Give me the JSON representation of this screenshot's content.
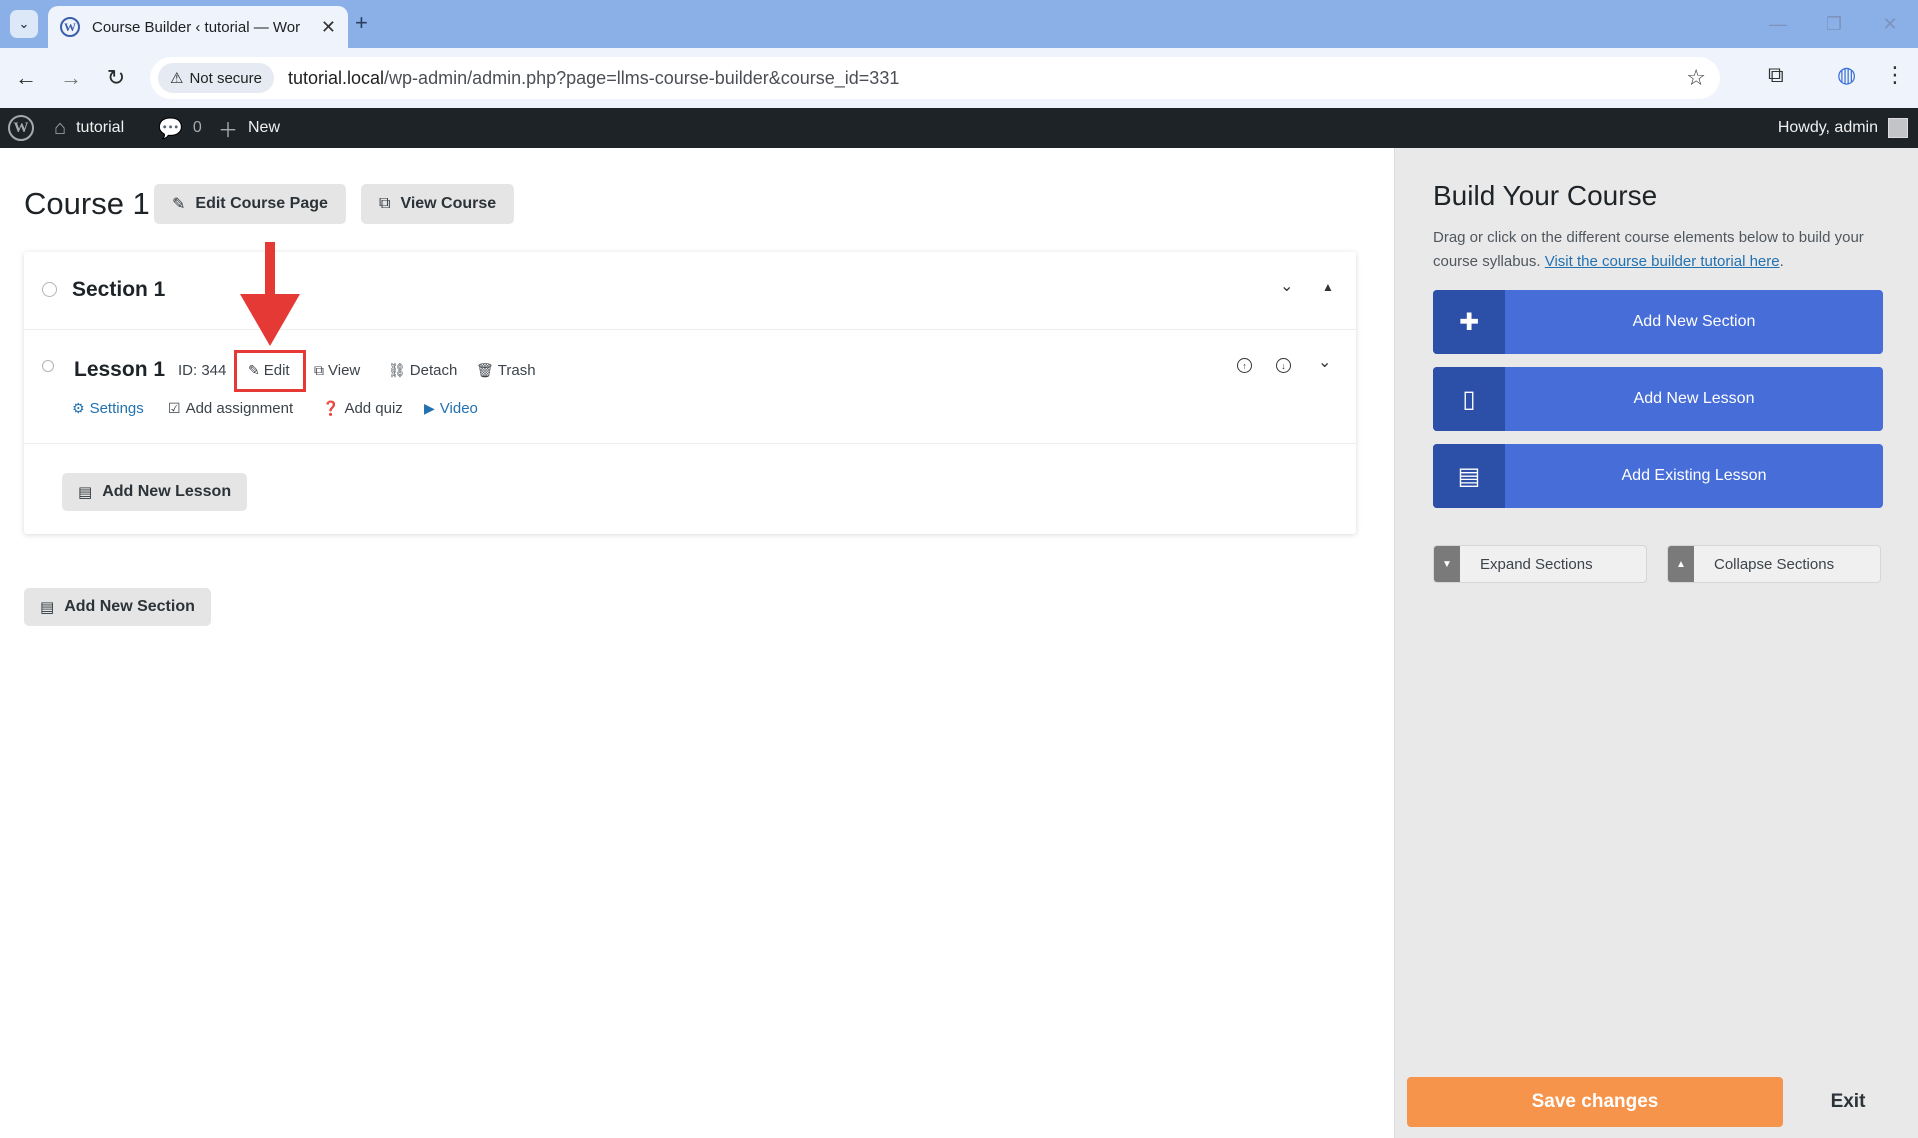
{
  "browser": {
    "tab_title": "Course Builder ‹ tutorial — Wor",
    "security_chip": "Not secure",
    "url_host": "tutorial.local",
    "url_path": "/wp-admin/admin.php?page=llms-course-builder&course_id=331"
  },
  "adminbar": {
    "site_name": "tutorial",
    "comments_count": "0",
    "new_label": "New",
    "greeting": "Howdy, admin"
  },
  "course": {
    "title": "Course 1",
    "edit_page_label": "Edit Course Page",
    "view_course_label": "View Course"
  },
  "section": {
    "title": "Section 1",
    "add_lesson_label": "Add New Lesson"
  },
  "lesson": {
    "title": "Lesson 1",
    "id_label": "ID: 344",
    "actions": [
      "Edit",
      "View",
      "Detach",
      "Trash"
    ],
    "sub_actions": [
      "Settings",
      "Add assignment",
      "Add quiz",
      "Video"
    ]
  },
  "add_section_label": "Add New Section",
  "sidebar": {
    "title": "Build Your Course",
    "description": "Drag or click on the different course elements below to build your course syllabus.",
    "tutorial_link": "Visit the course builder tutorial here",
    "tutorial_suffix": ".",
    "elements": [
      "Add New Section",
      "Add New Lesson",
      "Add Existing Lesson"
    ],
    "expand_label": "Expand Sections",
    "collapse_label": "Collapse Sections",
    "save_label": "Save changes",
    "exit_label": "Exit"
  },
  "colors": {
    "accent_blue": "#466dd8",
    "save_orange": "#f6944b",
    "annotation_red": "#e53935",
    "admin_bar": "#1d2327"
  }
}
